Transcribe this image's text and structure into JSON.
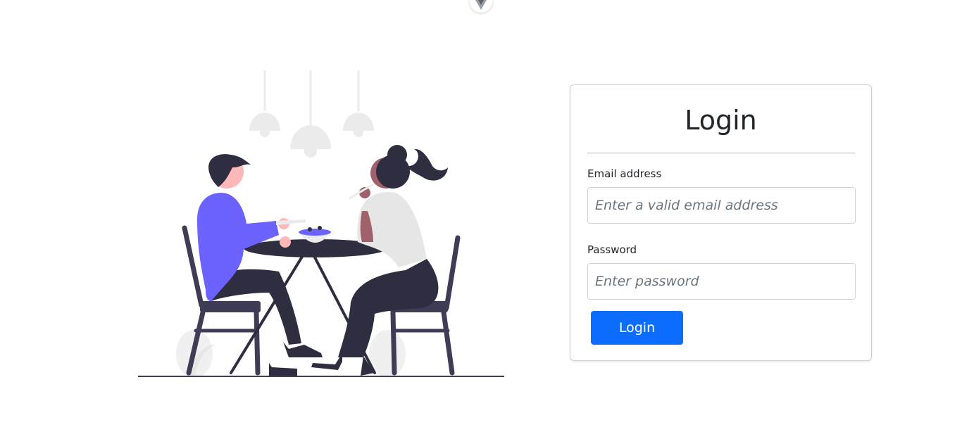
{
  "colors": {
    "accent": "#0d6efd",
    "illustration_purple": "#6c63ff",
    "illustration_dark": "#2f2e41",
    "skin_light": "#ffb8b8",
    "skin_dark": "#a0616a"
  },
  "top_badge": {
    "icon": "vue-logo-icon"
  },
  "illustration": {
    "icon": "dinner-couple-illustration"
  },
  "login_card": {
    "title": "Login",
    "email": {
      "label": "Email address",
      "placeholder": "Enter a valid email address",
      "value": ""
    },
    "password": {
      "label": "Password",
      "placeholder": "Enter password",
      "value": ""
    },
    "submit_label": "Login"
  }
}
